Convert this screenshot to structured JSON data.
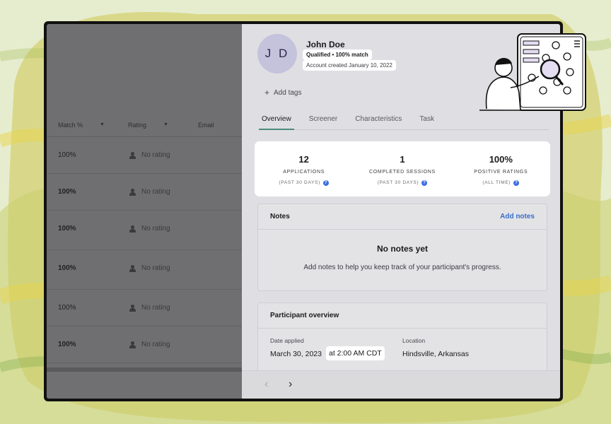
{
  "table": {
    "headers": {
      "match": "Match %",
      "rating": "Rating",
      "email": "Email"
    },
    "rows": [
      {
        "match": "100%",
        "rating": "No rating",
        "bold": false
      },
      {
        "match": "100%",
        "rating": "No rating",
        "bold": true
      },
      {
        "match": "100%",
        "rating": "No rating",
        "bold": true
      },
      {
        "match": "100%",
        "rating": "No rating",
        "bold": true
      },
      {
        "match": "100%",
        "rating": "No rating",
        "bold": false
      },
      {
        "match": "100%",
        "rating": "No rating",
        "bold": true
      }
    ]
  },
  "profile": {
    "initials": "J D",
    "name": "John Doe",
    "qualification": "Qualified • 100% match",
    "created": "Account created January 10, 2022",
    "add_tags": "Add tags"
  },
  "tabs": [
    "Overview",
    "Screener",
    "Characteristics",
    "Task"
  ],
  "active_tab": "Overview",
  "stats": [
    {
      "value": "12",
      "label": "APPLICATIONS",
      "sub": "(PAST 30 DAYS)"
    },
    {
      "value": "1",
      "label": "COMPLETED SESSIONS",
      "sub": "(PAST 30 DAYS)"
    },
    {
      "value": "100%",
      "label": "POSITIVE RATINGS",
      "sub": "(ALL TIME)"
    }
  ],
  "notes": {
    "title": "Notes",
    "add_label": "Add notes",
    "empty_title": "No notes yet",
    "empty_text": "Add notes to help you keep track of your participant's progress."
  },
  "overview": {
    "title": "Participant overview",
    "date_label": "Date applied",
    "date_value_pre": "March 30, 2023",
    "date_value_time": "at 2:00 AM CDT",
    "location_label": "Location",
    "location_value": "Hindsville, Arkansas"
  },
  "colors": {
    "background": "#e6edcf",
    "avatar": "#c5c2dc",
    "link": "#3a6ec8",
    "active_tab_underline": "#4e8a7e",
    "help_icon": "#3c6ee0"
  }
}
